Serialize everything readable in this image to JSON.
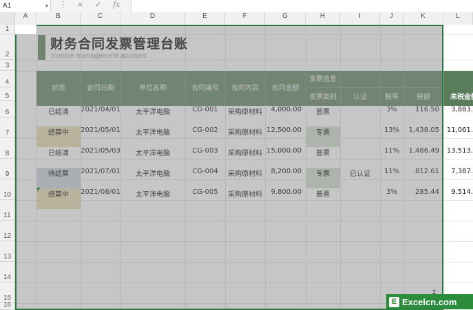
{
  "formula_bar": {
    "name_box": "A1",
    "cancel_icon": "×",
    "confirm_icon": "✓",
    "fx_label": "fx",
    "formula": ""
  },
  "columns": [
    "A",
    "B",
    "C",
    "D",
    "E",
    "F",
    "G",
    "H",
    "I",
    "J",
    "K",
    "L"
  ],
  "rows": [
    "1",
    "2",
    "3",
    "4",
    "5",
    "6",
    "7",
    "8",
    "9",
    "10",
    "11",
    "12",
    "13",
    "14",
    "15",
    "16"
  ],
  "sheet": {
    "title": "财务合同发票管理台账",
    "subtitle": "Invoice management account",
    "headers": {
      "status": "状态",
      "contract_date": "合同日期",
      "company": "单位名称",
      "contract_no": "合同编号",
      "contract_content": "合同内容",
      "contract_amount": "合同金额",
      "invoice_info": "发票信息",
      "invoice_type": "发票类别",
      "certification": "认证",
      "tax_rate": "税率",
      "tax_amount": "税额",
      "untaxed_amount": "未税金额"
    },
    "rows": [
      {
        "status": "已结清",
        "date": "2021/04/01",
        "company": "太平洋电脑",
        "no": "CG-001",
        "content": "采购原材料",
        "amount": "4,000.00",
        "type": "普票",
        "cert": "",
        "rate": "3%",
        "tax": "116.50",
        "untaxed": "3,883."
      },
      {
        "status": "结算中",
        "date": "2021/05/01",
        "company": "太平洋电脑",
        "no": "CG-002",
        "content": "采购原材料",
        "amount": "12,500.00",
        "type": "专票",
        "cert": "",
        "rate": "13%",
        "tax": "1,438.05",
        "untaxed": "11,061."
      },
      {
        "status": "已结清",
        "date": "2021/05/03",
        "company": "太平洋电脑",
        "no": "CG-003",
        "content": "采购原材料",
        "amount": "15,000.00",
        "type": "普票",
        "cert": "",
        "rate": "11%",
        "tax": "1,486.49",
        "untaxed": "13,513."
      },
      {
        "status": "待结算",
        "date": "2021/07/01",
        "company": "太平洋电脑",
        "no": "CG-004",
        "content": "采购原材料",
        "amount": "8,200.00",
        "type": "专票",
        "cert": "已认证",
        "rate": "11%",
        "tax": "812.61",
        "untaxed": "7,387."
      },
      {
        "status": "结算中",
        "date": "2021/08/01",
        "company": "太平洋电脑",
        "no": "CG-005",
        "content": "采购原材料",
        "amount": "9,800.00",
        "type": "普票",
        "cert": "",
        "rate": "3%",
        "tax": "285.44",
        "untaxed": "9,514."
      }
    ]
  },
  "watermark": {
    "logo": "E",
    "text": "Excelcn.com",
    "mark": "2"
  },
  "colors": {
    "header_fill": "#6f8f71",
    "title_accent": "#6b8f6b",
    "selection_border": "#2d7a44",
    "status_pending": "#e8dcb8",
    "status_waiting": "#cdd8df",
    "special_invoice": "#d3e0d0"
  }
}
